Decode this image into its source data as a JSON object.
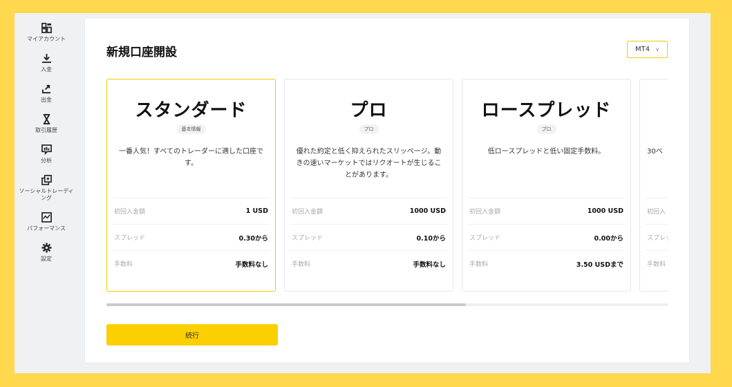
{
  "colors": {
    "background": "#ffd84d",
    "accent": "#f5c800",
    "button": "#fcd000"
  },
  "sidebar": {
    "items": [
      {
        "label": "マイアカウント",
        "icon": "grid-icon"
      },
      {
        "label": "入金",
        "icon": "download-icon"
      },
      {
        "label": "出金",
        "icon": "upload-icon"
      },
      {
        "label": "取引履歴",
        "icon": "hourglass-icon"
      },
      {
        "label": "分析",
        "icon": "chat-chart-icon"
      },
      {
        "label": "ソーシャルトレーディング",
        "icon": "copy-icon"
      },
      {
        "label": "パフォーマンス",
        "icon": "chart-box-icon"
      },
      {
        "label": "設定",
        "icon": "gear-icon"
      }
    ]
  },
  "main": {
    "title": "新規口座開設",
    "platform": {
      "selected": "MT4"
    },
    "cards": [
      {
        "name": "スタンダード",
        "badge": "基本情報",
        "description": "一番人気！すべてのトレーダーに適した口座です。",
        "rows": [
          {
            "label": "初回入金額",
            "value": "1 USD"
          },
          {
            "label": "スプレッド",
            "value": "0.30から"
          },
          {
            "label": "手数料",
            "value": "手数料なし"
          }
        ],
        "selected": true
      },
      {
        "name": "プロ",
        "badge": "プロ",
        "description": "優れた約定と低く抑えられたスリッページ。動きの速いマーケットではリクオートが生じることがあります。",
        "rows": [
          {
            "label": "初回入金額",
            "value": "1000 USD"
          },
          {
            "label": "スプレッド",
            "value": "0.10から"
          },
          {
            "label": "手数料",
            "value": "手数料なし"
          }
        ],
        "selected": false
      },
      {
        "name": "ロースプレッド",
        "badge": "プロ",
        "description": "低ロースプレッドと低い固定手数料。",
        "rows": [
          {
            "label": "初回入金額",
            "value": "1000 USD"
          },
          {
            "label": "スプレッド",
            "value": "0.00から"
          },
          {
            "label": "手数料",
            "value": "3.50 USDまで"
          }
        ],
        "selected": false
      },
      {
        "name": "",
        "badge": "",
        "description": "30ベ",
        "rows": [
          {
            "label": "初回入",
            "value": ""
          },
          {
            "label": "スプレッ",
            "value": ""
          },
          {
            "label": "手数料",
            "value": ""
          }
        ],
        "selected": false
      }
    ],
    "scroll_progress": 0.64,
    "continue_label": "続行"
  }
}
